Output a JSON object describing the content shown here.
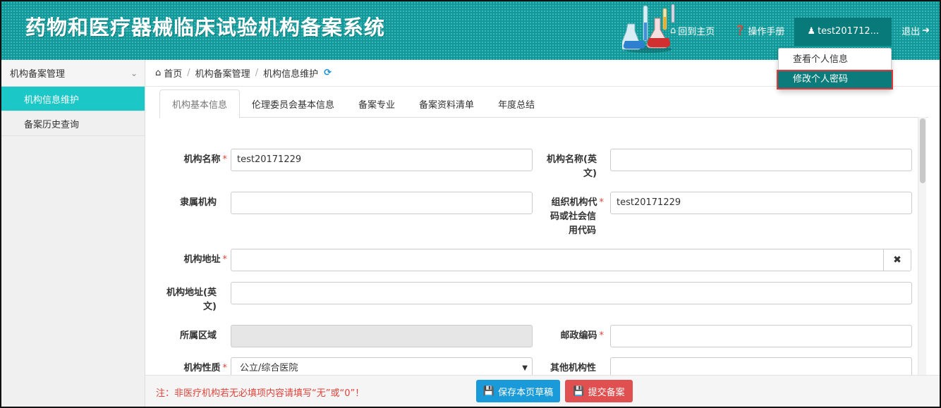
{
  "header": {
    "title": "药物和医疗器械临床试验机构备案系统",
    "nav": {
      "home": "回到主页",
      "manual": "操作手册",
      "user": "test201712...",
      "logout": "退出"
    }
  },
  "dropdown": {
    "items": [
      "查看个人信息",
      "修改个人密码"
    ]
  },
  "sidebar": {
    "group": "机构备案管理",
    "items": [
      "机构信息维护",
      "备案历史查询"
    ]
  },
  "breadcrumb": [
    "首页",
    "机构备案管理",
    "机构信息维护"
  ],
  "tabs": [
    "机构基本信息",
    "伦理委员会基本信息",
    "备案专业",
    "备案资料清单",
    "年度总结"
  ],
  "form": {
    "required_mark": "*",
    "org_name_label": "机构名称",
    "org_name_value": "test20171229",
    "org_name_en_label_1": "机构名称(英",
    "org_name_en_label_2": "文)",
    "affiliated_label": "隶属机构",
    "org_code_label_1": "组织机构代",
    "org_code_label_2": "码或社会信",
    "org_code_label_3": "用代码",
    "org_code_value": "test20171229",
    "address_label": "机构地址",
    "address_en_label_1": "机构地址(英",
    "address_en_label_2": "文)",
    "region_label": "所属区域",
    "postcode_label": "邮政编码",
    "nature_label": "机构性质",
    "nature_value": "公立/综合医院",
    "other_nature_label": "其他机构性"
  },
  "footer": {
    "note": "注：非医疗机构若无必填项内容请填写“无”或“0”！",
    "save_label": "保存本页草稿",
    "submit_label": "提交备案"
  }
}
